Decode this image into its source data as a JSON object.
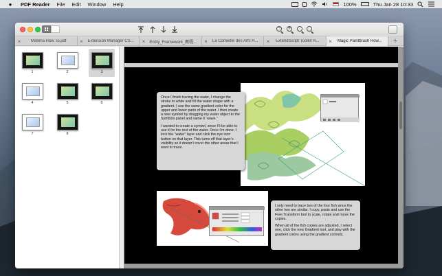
{
  "menubar": {
    "app_name": "PDF Reader",
    "menus": [
      "File",
      "Edit",
      "Window",
      "Help"
    ],
    "battery": "100%",
    "clock": "Thu Jan 28  10:33"
  },
  "toolbar": {
    "first_page_icon": "go-to-first-icon",
    "prev_page_icon": "page-up-icon",
    "next_page_icon": "page-down-icon",
    "last_page_icon": "go-to-last-icon",
    "zoom_icons": [
      "zoom-out-icon",
      "zoom-in-icon",
      "zoom-fit-icon",
      "zoom-actual-icon"
    ],
    "zoom_symbols": [
      "−",
      "+",
      "",
      ""
    ]
  },
  "tabs": [
    {
      "label": "Materia How To.pdf",
      "active": false
    },
    {
      "label": "Extension Manager CS...",
      "active": false
    },
    {
      "label": "Entity_Framework_教程...",
      "active": false
    },
    {
      "label": "La Comedie des Arts H...",
      "active": false
    },
    {
      "label": "ExtendScript Toolkit R...",
      "active": false
    },
    {
      "label": "Magic Paintbrush How...",
      "active": true
    }
  ],
  "thumbnails": [
    {
      "number": "1",
      "selected": false,
      "style": "dark"
    },
    {
      "number": "2",
      "selected": false,
      "style": "light"
    },
    {
      "number": "3",
      "selected": true,
      "style": "dark"
    },
    {
      "number": "4",
      "selected": false,
      "style": "light"
    },
    {
      "number": "5",
      "selected": false,
      "style": "dark"
    },
    {
      "number": "6",
      "selected": false,
      "style": "dark"
    },
    {
      "number": "7",
      "selected": false,
      "style": "light"
    },
    {
      "number": "8",
      "selected": false,
      "style": "dark"
    }
  ],
  "page": {
    "caption_1_p1": "Once I finish tracing the water, I change the stroke to white and fill the water shape with a gradient. I use the same gradient color for the upper and lower parts of the water. I then create a new symbol by dragging my water object to the Symbols panel and name it “wave.”",
    "caption_1_p2": "I wanted to create a symbol, since I’ll be able to use it for the rest of the water. Once I’m done, I lock the “water” layer and click the eye icon button on that layer. This turns off that layer’s visibility so it doesn’t cover the other areas that I want to trace.",
    "caption_2_p1": "I only need to trace two of the four fish since the other two are similar. I copy, paste and use the Free Transform tool to scale, rotate and move the copies.",
    "caption_2_p2": "When all of the fish copies are adjusted, I select one, click the new Gradient tool, and play with the gradient colors using the gradient controls."
  },
  "colors": {
    "wave_green": "#b9d86a",
    "wave_teal": "#7fc6a8",
    "fish_red": "#d64a3e",
    "caption_bg": "#d7d7d7"
  }
}
